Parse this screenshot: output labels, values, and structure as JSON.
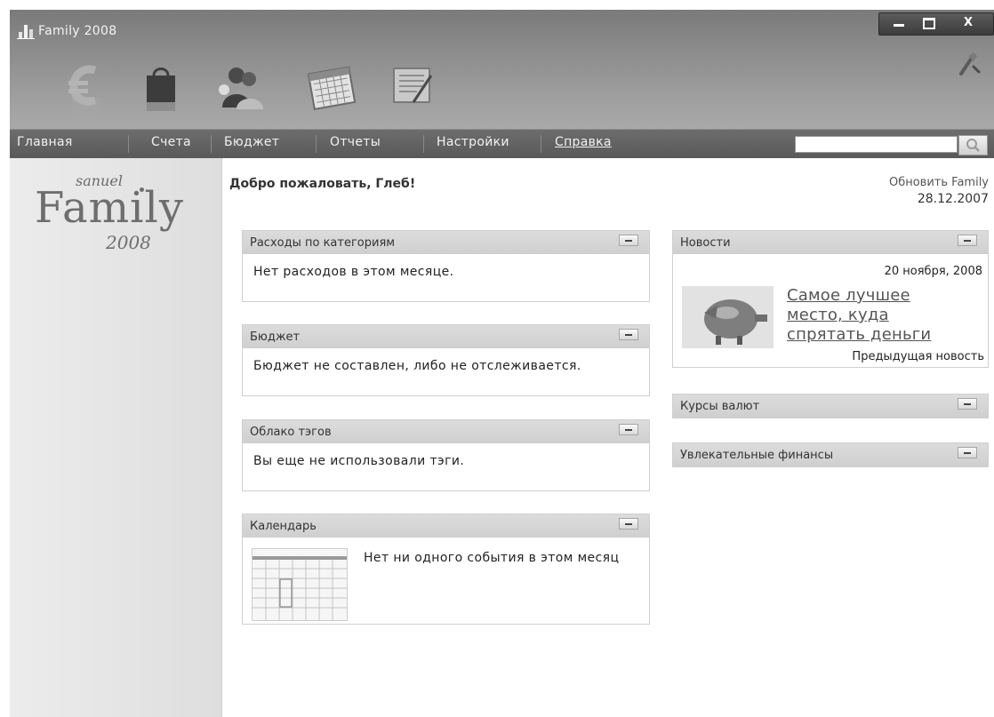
{
  "app": {
    "title": "Family 2008",
    "window_controls": {
      "close": "X"
    }
  },
  "nav": {
    "items": [
      "Главная",
      "Счета",
      "Бюджет",
      "Отчеты",
      "Настройки",
      "Справка"
    ],
    "search": {
      "value": "",
      "placeholder": ""
    }
  },
  "brand": {
    "sanuel": "sanuel",
    "family": "Family",
    "year": "2008"
  },
  "header": {
    "welcome": "Добро пожаловать, Глеб!",
    "update_label": "Обновить Family",
    "update_date": "28.12.2007"
  },
  "widgets": {
    "expenses": {
      "title": "Расходы по категориям",
      "text": "Нет расходов в этом месяце."
    },
    "budget": {
      "title": "Бюджет",
      "text": "Бюджет не составлен, либо не отслеживается."
    },
    "tags": {
      "title": "Облако тэгов",
      "text": "Вы еще не использовали тэги."
    },
    "calendar": {
      "title": "Календарь",
      "text": "Нет ни одного события в этом месяц"
    },
    "news": {
      "title": "Новости",
      "date": "20 ноября, 2008",
      "headline": "Самое лучшее место, куда спрятать деньги",
      "prev_link": "Предыдущая новость"
    },
    "rates": {
      "title": "Курсы валют"
    },
    "finance": {
      "title": "Увлекательные финансы"
    }
  },
  "icons": [
    "app-logo",
    "euro",
    "shopping-bag",
    "people",
    "calendar",
    "ledger",
    "tools",
    "search"
  ],
  "colors": {
    "toolbar": "#8c8c8c",
    "navbar": "#616161",
    "widget_header": "#d6d6d6",
    "panel": "#e6e6e6"
  }
}
